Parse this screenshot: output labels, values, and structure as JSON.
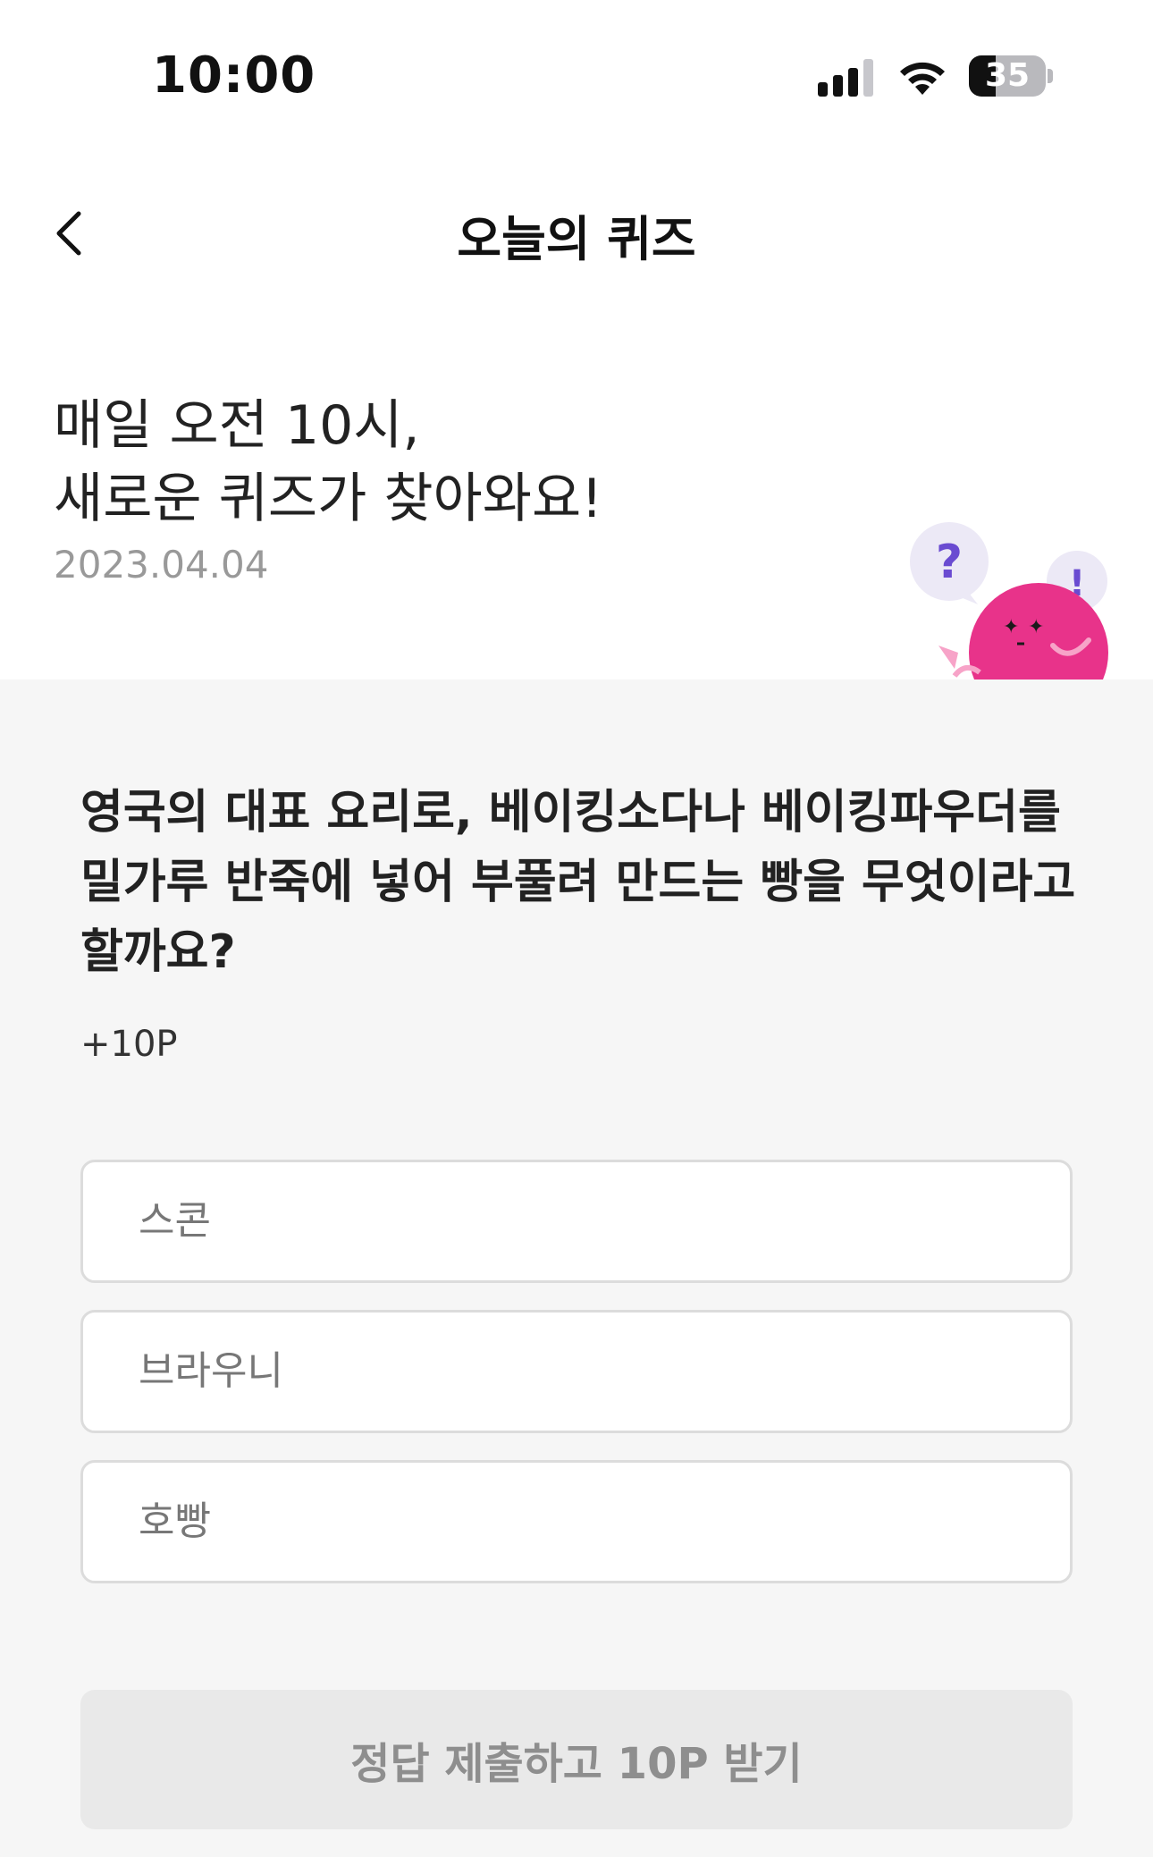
{
  "status_bar": {
    "time": "10:00",
    "battery_level": "35",
    "icons": [
      "cellular-signal-icon",
      "wifi-icon",
      "battery-icon"
    ]
  },
  "nav": {
    "title": "오늘의 퀴즈",
    "back_icon": "chevron-left-icon"
  },
  "hero": {
    "headline_line1": "매일 오전 10시,",
    "headline_line2": "새로운 퀴즈가 찾아와요!",
    "date": "2023.04.04",
    "mascot": {
      "question_mark": "?",
      "exclamation_mark": "!"
    }
  },
  "quiz": {
    "question": "영국의 대표 요리로, 베이킹소다나 베이킹파우더를 밀가루 반죽에 넣어 부풀려 만드는 빵을 무엇이라고 할까요?",
    "points": "+10P",
    "options": [
      {
        "label": "스콘"
      },
      {
        "label": "브라우니"
      },
      {
        "label": "호빵"
      }
    ],
    "submit_label": "정답 제출하고 10P 받기"
  },
  "colors": {
    "accent_pink": "#e8338a",
    "bubble_bg": "#ece9f6",
    "mark_purple": "#6a4bd1",
    "quiz_bg": "#f6f6f6",
    "button_disabled_bg": "#e9e9e9",
    "button_disabled_text": "#8e8e8e"
  }
}
